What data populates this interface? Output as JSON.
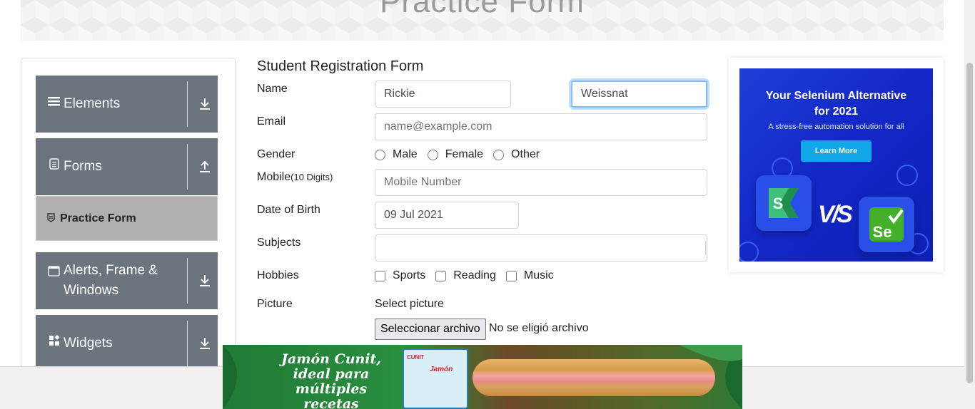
{
  "header": {
    "title": "Practice Form"
  },
  "sidebar": {
    "groups": [
      {
        "label": "Elements",
        "icon": "hamburger-icon",
        "arrow": "download-arrow-icon"
      },
      {
        "label": "Forms",
        "icon": "document-icon",
        "arrow": "upload-arrow-icon"
      },
      {
        "label": "Alerts, Frame & Windows",
        "icon": "window-icon",
        "arrow": "download-arrow-icon"
      },
      {
        "label": "Widgets",
        "icon": "widgets-icon",
        "arrow": "download-arrow-icon"
      }
    ],
    "active_item": {
      "label": "Practice Form",
      "icon": "badge-icon"
    }
  },
  "form": {
    "title": "Student Registration Form",
    "name": {
      "label": "Name",
      "first_value": "Rickie",
      "last_value": "Weissnat"
    },
    "email": {
      "label": "Email",
      "placeholder": "name@example.com"
    },
    "gender": {
      "label": "Gender",
      "options": [
        "Male",
        "Female",
        "Other"
      ]
    },
    "mobile": {
      "label": "Mobile",
      "hint": "(10 Digits)",
      "placeholder": "Mobile Number"
    },
    "dob": {
      "label": "Date of Birth",
      "value": "09 Jul 2021"
    },
    "subjects": {
      "label": "Subjects",
      "value": ""
    },
    "hobbies": {
      "label": "Hobbies",
      "options": [
        "Sports",
        "Reading",
        "Music"
      ]
    },
    "picture": {
      "label": "Picture",
      "select_text": "Select picture",
      "button_label": "Seleccionar archivo",
      "no_file_text": "No se eligió archivo"
    }
  },
  "right_ad": {
    "title_line1": "Your Selenium Alternative",
    "title_line2": "for 2021",
    "subtitle": "A stress-free automation solution for all",
    "button_label": "Learn More",
    "vs_text": "V/S",
    "logo_left": "S",
    "logo_right": "Se"
  },
  "bottom_ad": {
    "line1": "Jamón Cunit,",
    "line2": "ideal para",
    "line3": "múltiples recetas",
    "pack_brand": "CUNIT",
    "pack_name": "Jamón"
  }
}
